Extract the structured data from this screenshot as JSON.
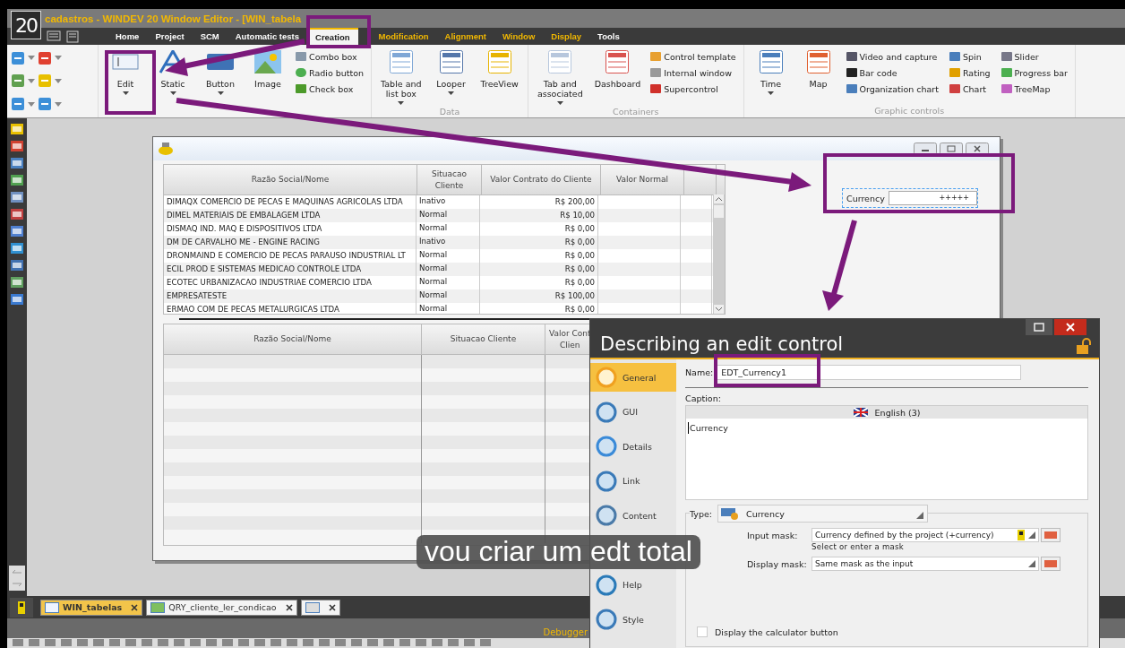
{
  "app": {
    "logo": "20",
    "title": "cadastros - WINDEV 20  Window Editor - [WIN_tabela"
  },
  "menu_tabs": [
    {
      "label": "Home",
      "kind": "standard",
      "selected": false
    },
    {
      "label": "Project",
      "kind": "standard",
      "selected": false
    },
    {
      "label": "SCM",
      "kind": "standard",
      "selected": false
    },
    {
      "label": "Automatic tests",
      "kind": "standard",
      "selected": false
    },
    {
      "label": "Creation",
      "kind": "standard",
      "selected": true
    },
    {
      "label": "Modification",
      "kind": "contextual",
      "selected": false
    },
    {
      "label": "Alignment",
      "kind": "contextual",
      "selected": false
    },
    {
      "label": "Window",
      "kind": "contextual",
      "selected": false
    },
    {
      "label": "Display",
      "kind": "contextual",
      "selected": false
    },
    {
      "label": "Tools",
      "kind": "standard",
      "selected": false
    }
  ],
  "ribbon": {
    "usual": {
      "big": [
        {
          "label": "Edit",
          "dropdown": true
        },
        {
          "label": "Static",
          "dropdown": true
        },
        {
          "label": "Button",
          "dropdown": true
        },
        {
          "label": "Image",
          "dropdown": false
        }
      ],
      "small": [
        {
          "label": "Combo box"
        },
        {
          "label": "Radio button"
        },
        {
          "label": "Check box"
        }
      ]
    },
    "data": {
      "label": "Data",
      "big": [
        {
          "label": "Table and\nlist box",
          "dropdown": true
        },
        {
          "label": "Looper",
          "dropdown": true
        },
        {
          "label": "TreeView",
          "dropdown": false
        }
      ]
    },
    "containers": {
      "label": "Containers",
      "big": [
        {
          "label": "Tab and\nassociated",
          "dropdown": true
        },
        {
          "label": "Dashboard",
          "dropdown": false
        }
      ],
      "small": [
        {
          "label": "Control template"
        },
        {
          "label": "Internal window"
        },
        {
          "label": "Supercontrol"
        }
      ]
    },
    "graphic": {
      "label": "Graphic controls",
      "big": [
        {
          "label": "Time",
          "dropdown": true
        },
        {
          "label": "Map",
          "dropdown": false
        }
      ],
      "small": [
        {
          "label": "Video and capture"
        },
        {
          "label": "Bar code"
        },
        {
          "label": "Organization chart"
        },
        {
          "label": "Spin"
        },
        {
          "label": "Rating"
        },
        {
          "label": "Chart"
        },
        {
          "label": "Slider"
        },
        {
          "label": "Progress bar"
        },
        {
          "label": "TreeMap"
        }
      ]
    }
  },
  "table_top": {
    "columns": [
      "Razão Social/Nome",
      "Situacao\nCliente",
      "Valor Contrato do Cliente",
      "Valor Normal"
    ],
    "rows": [
      [
        "DIMAQX COMERCIO DE PECAS E MAQUINAS AGRICOLAS LTDA",
        "Inativo",
        "R$ 200,00"
      ],
      [
        "DIMEL MATERIAIS DE EMBALAGEM LTDA",
        "Normal",
        "R$ 10,00"
      ],
      [
        "DISMAQ IND. MAQ E DISPOSITIVOS LTDA",
        "Normal",
        "R$ 0,00"
      ],
      [
        "DM DE CARVALHO ME - ENGINE RACING",
        "Inativo",
        "R$ 0,00"
      ],
      [
        "DRONMAIND E COMERCIO DE PECAS PARAUSO INDUSTRIAL LT",
        "Normal",
        "R$ 0,00"
      ],
      [
        "ECIL PROD E SISTEMAS MEDICAO CONTROLE LTDA",
        "Normal",
        "R$ 0,00"
      ],
      [
        "ECOTEC URBANIZACAO INDUSTRIAE COMERCIO LTDA",
        "Normal",
        "R$ 0,00"
      ],
      [
        "EMPRESATESTE",
        "Normal",
        "R$ 100,00"
      ],
      [
        "ERMAO COM DE PECAS METALURGICAS LTDA",
        "Normal",
        "R$ 0,00"
      ]
    ]
  },
  "currency_control": {
    "caption": "Currency",
    "value": "+++++"
  },
  "table_bottom": {
    "columns": [
      "Razão Social/Nome",
      "Situacao Cliente",
      "Valor Cont\nClien"
    ]
  },
  "dialog": {
    "title": "Describing an edit control",
    "nav": [
      {
        "label": "General",
        "selected": true
      },
      {
        "label": "GUI",
        "selected": false
      },
      {
        "label": "Details",
        "selected": false
      },
      {
        "label": "Link",
        "selected": false
      },
      {
        "label": "Content",
        "selected": false
      },
      {
        "label": "Help",
        "selected": false
      },
      {
        "label": "Style",
        "selected": false
      }
    ],
    "name_label": "Name:",
    "name_value": "EDT_Currency1",
    "caption_label": "Caption:",
    "language": "English (3)",
    "caption_value": "Currency",
    "type_label": "Type:",
    "type_value": "Currency",
    "input_mask_label": "Input mask:",
    "input_mask_value": "Currency defined by the project (+currency)",
    "input_mask_hint": "Select or enter a mask",
    "display_mask_label": "Display mask:",
    "display_mask_value": "Same mask as the input",
    "calculator": {
      "label": "Display the calculator button",
      "checked": false
    }
  },
  "subtitle": "vou criar um edt total",
  "doc_tabs": [
    {
      "label": "WIN_tabelas",
      "selected": true
    },
    {
      "label": "QRY_cliente_ler_condicao",
      "selected": false
    },
    {
      "selected": false
    }
  ],
  "status": {
    "panel": "Debugger"
  }
}
